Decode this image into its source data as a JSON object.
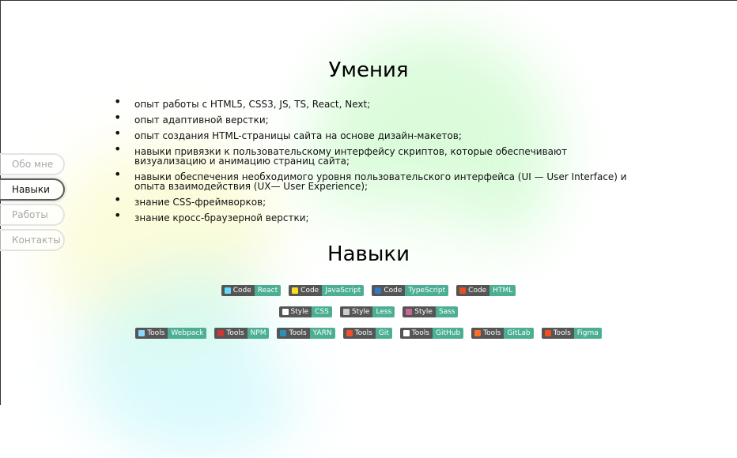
{
  "nav": {
    "items": [
      {
        "label": "Обо мне"
      },
      {
        "label": "Навыки"
      },
      {
        "label": "Работы"
      },
      {
        "label": "Контакты"
      }
    ],
    "active": "Навыки"
  },
  "skills_section": {
    "title": "Умения",
    "items": [
      "опыт работы с HTML5, CSS3, JS, TS, React, Next;",
      "опыт адаптивной верстки;",
      "опыт создания HTML-страницы сайта на основе дизайн-макетов;",
      "навыки привязки к пользовательскому интерфейсу скриптов, которые обеспечивают визуализацию и анимацию страниц сайта;",
      "навыки обеспечения необходимого уровня пользовательского интерфейса (UI — User Interface) и опыта взаимодействия (UX— User Experience);",
      "знание CSS-фреймворков;",
      "знание кросс-браузерной верстки;"
    ]
  },
  "badges_section": {
    "title": "Навыки",
    "rows": [
      [
        {
          "label": "Code",
          "value": "React",
          "icon": "react-icon",
          "icon_color": "#61dafb"
        },
        {
          "label": "Code",
          "value": "JavaScript",
          "icon": "javascript-icon",
          "icon_color": "#f7df1e"
        },
        {
          "label": "Code",
          "value": "TypeScript",
          "icon": "typescript-icon",
          "icon_color": "#3178c6"
        },
        {
          "label": "Code",
          "value": "HTML",
          "icon": "html-icon",
          "icon_color": "#e34f26"
        }
      ],
      [
        {
          "label": "Style",
          "value": "CSS",
          "icon": "css-icon",
          "icon_color": "#ffffff"
        },
        {
          "label": "Style",
          "value": "Less",
          "icon": "less-icon",
          "icon_color": "#cccccc"
        },
        {
          "label": "Style",
          "value": "Sass",
          "icon": "sass-icon",
          "icon_color": "#cc6699"
        }
      ],
      [
        {
          "label": "Tools",
          "value": "Webpack",
          "icon": "webpack-icon",
          "icon_color": "#8ed6fb"
        },
        {
          "label": "Tools",
          "value": "NPM",
          "icon": "npm-icon",
          "icon_color": "#cb3837"
        },
        {
          "label": "Tools",
          "value": "YARN",
          "icon": "yarn-icon",
          "icon_color": "#2c8ebb"
        },
        {
          "label": "Tools",
          "value": "Git",
          "icon": "git-icon",
          "icon_color": "#f05032"
        },
        {
          "label": "Tools",
          "value": "GitHub",
          "icon": "github-icon",
          "icon_color": "#ffffff"
        },
        {
          "label": "Tools",
          "value": "GitLab",
          "icon": "gitlab-icon",
          "icon_color": "#fc6d26"
        },
        {
          "label": "Tools",
          "value": "Figma",
          "icon": "figma-icon",
          "icon_color": "#f24e1e"
        }
      ]
    ]
  },
  "colors": {
    "badge_label_bg": "#555555",
    "badge_value_bg": "#4caf93"
  }
}
